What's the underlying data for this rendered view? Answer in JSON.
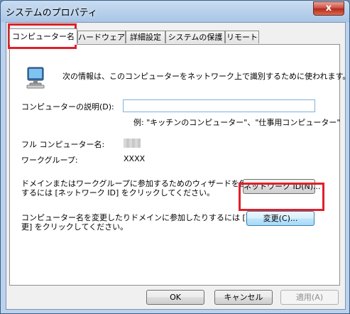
{
  "window": {
    "title": "システムのプロパティ",
    "close_label": "x"
  },
  "tabs": [
    {
      "label": "コンピューター名"
    },
    {
      "label": "ハードウェア"
    },
    {
      "label": "詳細設定"
    },
    {
      "label": "システムの保護"
    },
    {
      "label": "リモート"
    }
  ],
  "panel": {
    "intro": "次の情報は、このコンピューターをネットワーク上で識別するために使われます。",
    "description_label": "コンピューターの説明(D):",
    "description_value": "",
    "example": "例: \"キッチンのコンピューター\"、\"仕事用コンピューター\"",
    "full_name_label": "フル コンピューター名:",
    "workgroup_label": "ワークグループ:",
    "workgroup_value": "XXXX",
    "network_text_1": "ドメインまたはワークグループに参加するためのウィザードを使用",
    "network_text_2": "するには [ネットワーク ID] をクリックしてください。",
    "network_button": "ネットワーク ID(N)...",
    "change_text_1": "コンピューター名を変更したりドメインに参加したりするには [変",
    "change_text_2": "更] をクリックしてください。",
    "change_button": "変更(C)..."
  },
  "footer": {
    "ok": "OK",
    "cancel": "キャンセル",
    "apply": "適用(A)"
  },
  "colors": {
    "highlight": "#e0202a",
    "title_bg": "#a9c5e6",
    "close_bg": "#c9473a"
  },
  "icons": {
    "computer": "computer-icon",
    "close": "close-icon"
  }
}
